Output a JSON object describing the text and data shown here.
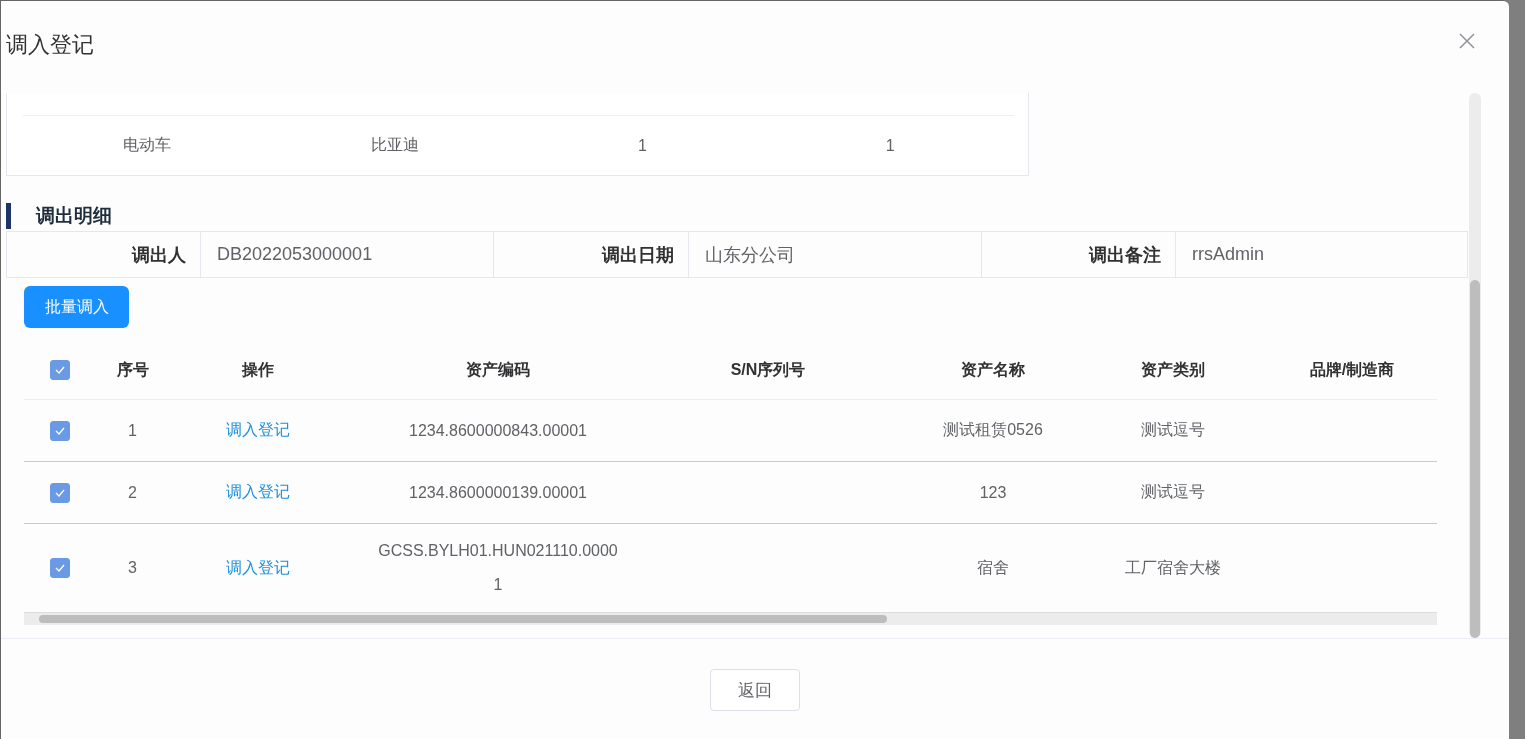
{
  "dialog": {
    "title": "调入登记"
  },
  "summary_table": {
    "rows": [
      [
        "电动车",
        "比亚迪",
        "1",
        "1"
      ]
    ]
  },
  "section": {
    "title": "调出明细"
  },
  "details": [
    {
      "label": "调出人",
      "value": "DB2022053000001"
    },
    {
      "label": "调出日期",
      "value": "山东分公司"
    },
    {
      "label": "调出备注",
      "value": "rrsAdmin"
    }
  ],
  "batch_button": "批量调入",
  "table": {
    "all_checked": true,
    "columns": [
      "序号",
      "操作",
      "资产编码",
      "S/N序列号",
      "资产名称",
      "资产类别",
      "品牌/制造商"
    ],
    "rows": [
      {
        "checked": true,
        "index": "1",
        "action": "调入登记",
        "code": "1234.8600000843.00001",
        "name": "测试租赁0526",
        "category": "测试逗号"
      },
      {
        "checked": true,
        "index": "2",
        "action": "调入登记",
        "code": "1234.8600000139.00001",
        "name": "123",
        "category": "测试逗号"
      },
      {
        "checked": true,
        "index": "3",
        "action": "调入登记",
        "code": "GCSS.BYLH01.HUN021110.00001",
        "name": "宿舍",
        "category": "工厂宿舍大楼"
      }
    ]
  },
  "footer": {
    "back_button": "返回"
  }
}
